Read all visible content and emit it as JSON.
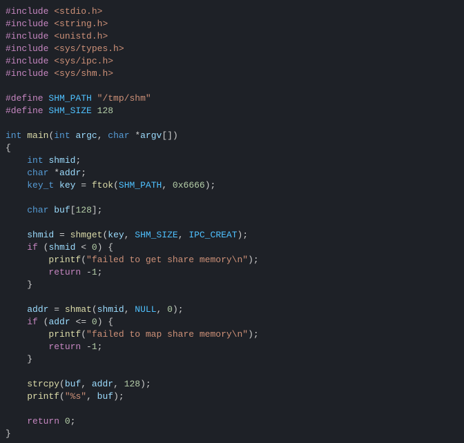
{
  "code": {
    "lines": [
      [
        {
          "c": "tok-pp",
          "t": "#include"
        },
        {
          "c": "tok-plain",
          "t": " "
        },
        {
          "c": "tok-str",
          "t": "<stdio.h>"
        }
      ],
      [
        {
          "c": "tok-pp",
          "t": "#include"
        },
        {
          "c": "tok-plain",
          "t": " "
        },
        {
          "c": "tok-str",
          "t": "<string.h>"
        }
      ],
      [
        {
          "c": "tok-pp",
          "t": "#include"
        },
        {
          "c": "tok-plain",
          "t": " "
        },
        {
          "c": "tok-str",
          "t": "<unistd.h>"
        }
      ],
      [
        {
          "c": "tok-pp",
          "t": "#include"
        },
        {
          "c": "tok-plain",
          "t": " "
        },
        {
          "c": "tok-str",
          "t": "<sys/types.h>"
        }
      ],
      [
        {
          "c": "tok-pp",
          "t": "#include"
        },
        {
          "c": "tok-plain",
          "t": " "
        },
        {
          "c": "tok-str",
          "t": "<sys/ipc.h>"
        }
      ],
      [
        {
          "c": "tok-pp",
          "t": "#include"
        },
        {
          "c": "tok-plain",
          "t": " "
        },
        {
          "c": "tok-str",
          "t": "<sys/shm.h>"
        }
      ],
      [],
      [
        {
          "c": "tok-pp",
          "t": "#define"
        },
        {
          "c": "tok-plain",
          "t": " "
        },
        {
          "c": "tok-const",
          "t": "SHM_PATH"
        },
        {
          "c": "tok-plain",
          "t": " "
        },
        {
          "c": "tok-str",
          "t": "\"/tmp/shm\""
        }
      ],
      [
        {
          "c": "tok-pp",
          "t": "#define"
        },
        {
          "c": "tok-plain",
          "t": " "
        },
        {
          "c": "tok-const",
          "t": "SHM_SIZE"
        },
        {
          "c": "tok-plain",
          "t": " "
        },
        {
          "c": "tok-num",
          "t": "128"
        }
      ],
      [],
      [
        {
          "c": "tok-kw",
          "t": "int"
        },
        {
          "c": "tok-plain",
          "t": " "
        },
        {
          "c": "tok-fn",
          "t": "main"
        },
        {
          "c": "tok-plain",
          "t": "("
        },
        {
          "c": "tok-kw",
          "t": "int"
        },
        {
          "c": "tok-plain",
          "t": " "
        },
        {
          "c": "tok-id",
          "t": "argc"
        },
        {
          "c": "tok-plain",
          "t": ", "
        },
        {
          "c": "tok-kw",
          "t": "char"
        },
        {
          "c": "tok-plain",
          "t": " *"
        },
        {
          "c": "tok-id",
          "t": "argv"
        },
        {
          "c": "tok-plain",
          "t": "[])"
        }
      ],
      [
        {
          "c": "tok-plain",
          "t": "{"
        }
      ],
      [
        {
          "c": "tok-plain",
          "t": "    "
        },
        {
          "c": "tok-kw",
          "t": "int"
        },
        {
          "c": "tok-plain",
          "t": " "
        },
        {
          "c": "tok-id",
          "t": "shmid"
        },
        {
          "c": "tok-plain",
          "t": ";"
        }
      ],
      [
        {
          "c": "tok-plain",
          "t": "    "
        },
        {
          "c": "tok-kw",
          "t": "char"
        },
        {
          "c": "tok-plain",
          "t": " *"
        },
        {
          "c": "tok-id",
          "t": "addr"
        },
        {
          "c": "tok-plain",
          "t": ";"
        }
      ],
      [
        {
          "c": "tok-plain",
          "t": "    "
        },
        {
          "c": "tok-kw",
          "t": "key_t"
        },
        {
          "c": "tok-plain",
          "t": " "
        },
        {
          "c": "tok-id",
          "t": "key"
        },
        {
          "c": "tok-plain",
          "t": " = "
        },
        {
          "c": "tok-fn",
          "t": "ftok"
        },
        {
          "c": "tok-plain",
          "t": "("
        },
        {
          "c": "tok-const",
          "t": "SHM_PATH"
        },
        {
          "c": "tok-plain",
          "t": ", "
        },
        {
          "c": "tok-num",
          "t": "0x6666"
        },
        {
          "c": "tok-plain",
          "t": ");"
        }
      ],
      [],
      [
        {
          "c": "tok-plain",
          "t": "    "
        },
        {
          "c": "tok-kw",
          "t": "char"
        },
        {
          "c": "tok-plain",
          "t": " "
        },
        {
          "c": "tok-id",
          "t": "buf"
        },
        {
          "c": "tok-plain",
          "t": "["
        },
        {
          "c": "tok-num",
          "t": "128"
        },
        {
          "c": "tok-plain",
          "t": "];"
        }
      ],
      [],
      [
        {
          "c": "tok-plain",
          "t": "    "
        },
        {
          "c": "tok-id",
          "t": "shmid"
        },
        {
          "c": "tok-plain",
          "t": " = "
        },
        {
          "c": "tok-fn",
          "t": "shmget"
        },
        {
          "c": "tok-plain",
          "t": "("
        },
        {
          "c": "tok-id",
          "t": "key"
        },
        {
          "c": "tok-plain",
          "t": ", "
        },
        {
          "c": "tok-const",
          "t": "SHM_SIZE"
        },
        {
          "c": "tok-plain",
          "t": ", "
        },
        {
          "c": "tok-const",
          "t": "IPC_CREAT"
        },
        {
          "c": "tok-plain",
          "t": ");"
        }
      ],
      [
        {
          "c": "tok-plain",
          "t": "    "
        },
        {
          "c": "tok-pp",
          "t": "if"
        },
        {
          "c": "tok-plain",
          "t": " ("
        },
        {
          "c": "tok-id",
          "t": "shmid"
        },
        {
          "c": "tok-plain",
          "t": " < "
        },
        {
          "c": "tok-num",
          "t": "0"
        },
        {
          "c": "tok-plain",
          "t": ") {"
        }
      ],
      [
        {
          "c": "tok-plain",
          "t": "        "
        },
        {
          "c": "tok-fn",
          "t": "printf"
        },
        {
          "c": "tok-plain",
          "t": "("
        },
        {
          "c": "tok-str",
          "t": "\"failed to get share memory\\n\""
        },
        {
          "c": "tok-plain",
          "t": ");"
        }
      ],
      [
        {
          "c": "tok-plain",
          "t": "        "
        },
        {
          "c": "tok-pp",
          "t": "return"
        },
        {
          "c": "tok-plain",
          "t": " -"
        },
        {
          "c": "tok-num",
          "t": "1"
        },
        {
          "c": "tok-plain",
          "t": ";"
        }
      ],
      [
        {
          "c": "tok-plain",
          "t": "    }"
        }
      ],
      [],
      [
        {
          "c": "tok-plain",
          "t": "    "
        },
        {
          "c": "tok-id",
          "t": "addr"
        },
        {
          "c": "tok-plain",
          "t": " = "
        },
        {
          "c": "tok-fn",
          "t": "shmat"
        },
        {
          "c": "tok-plain",
          "t": "("
        },
        {
          "c": "tok-id",
          "t": "shmid"
        },
        {
          "c": "tok-plain",
          "t": ", "
        },
        {
          "c": "tok-const",
          "t": "NULL"
        },
        {
          "c": "tok-plain",
          "t": ", "
        },
        {
          "c": "tok-num",
          "t": "0"
        },
        {
          "c": "tok-plain",
          "t": ");"
        }
      ],
      [
        {
          "c": "tok-plain",
          "t": "    "
        },
        {
          "c": "tok-pp",
          "t": "if"
        },
        {
          "c": "tok-plain",
          "t": " ("
        },
        {
          "c": "tok-id",
          "t": "addr"
        },
        {
          "c": "tok-plain",
          "t": " <= "
        },
        {
          "c": "tok-num",
          "t": "0"
        },
        {
          "c": "tok-plain",
          "t": ") {"
        }
      ],
      [
        {
          "c": "tok-plain",
          "t": "        "
        },
        {
          "c": "tok-fn",
          "t": "printf"
        },
        {
          "c": "tok-plain",
          "t": "("
        },
        {
          "c": "tok-str",
          "t": "\"failed to map share memory\\n\""
        },
        {
          "c": "tok-plain",
          "t": ");"
        }
      ],
      [
        {
          "c": "tok-plain",
          "t": "        "
        },
        {
          "c": "tok-pp",
          "t": "return"
        },
        {
          "c": "tok-plain",
          "t": " -"
        },
        {
          "c": "tok-num",
          "t": "1"
        },
        {
          "c": "tok-plain",
          "t": ";"
        }
      ],
      [
        {
          "c": "tok-plain",
          "t": "    }"
        }
      ],
      [],
      [
        {
          "c": "tok-plain",
          "t": "    "
        },
        {
          "c": "tok-fn",
          "t": "strcpy"
        },
        {
          "c": "tok-plain",
          "t": "("
        },
        {
          "c": "tok-id",
          "t": "buf"
        },
        {
          "c": "tok-plain",
          "t": ", "
        },
        {
          "c": "tok-id",
          "t": "addr"
        },
        {
          "c": "tok-plain",
          "t": ", "
        },
        {
          "c": "tok-num",
          "t": "128"
        },
        {
          "c": "tok-plain",
          "t": ");"
        }
      ],
      [
        {
          "c": "tok-plain",
          "t": "    "
        },
        {
          "c": "tok-fn",
          "t": "printf"
        },
        {
          "c": "tok-plain",
          "t": "("
        },
        {
          "c": "tok-str",
          "t": "\"%s\""
        },
        {
          "c": "tok-plain",
          "t": ", "
        },
        {
          "c": "tok-id",
          "t": "buf"
        },
        {
          "c": "tok-plain",
          "t": ");"
        }
      ],
      [],
      [
        {
          "c": "tok-plain",
          "t": "    "
        },
        {
          "c": "tok-pp",
          "t": "return"
        },
        {
          "c": "tok-plain",
          "t": " "
        },
        {
          "c": "tok-num",
          "t": "0"
        },
        {
          "c": "tok-plain",
          "t": ";"
        }
      ],
      [
        {
          "c": "tok-plain",
          "t": "}"
        }
      ]
    ]
  }
}
